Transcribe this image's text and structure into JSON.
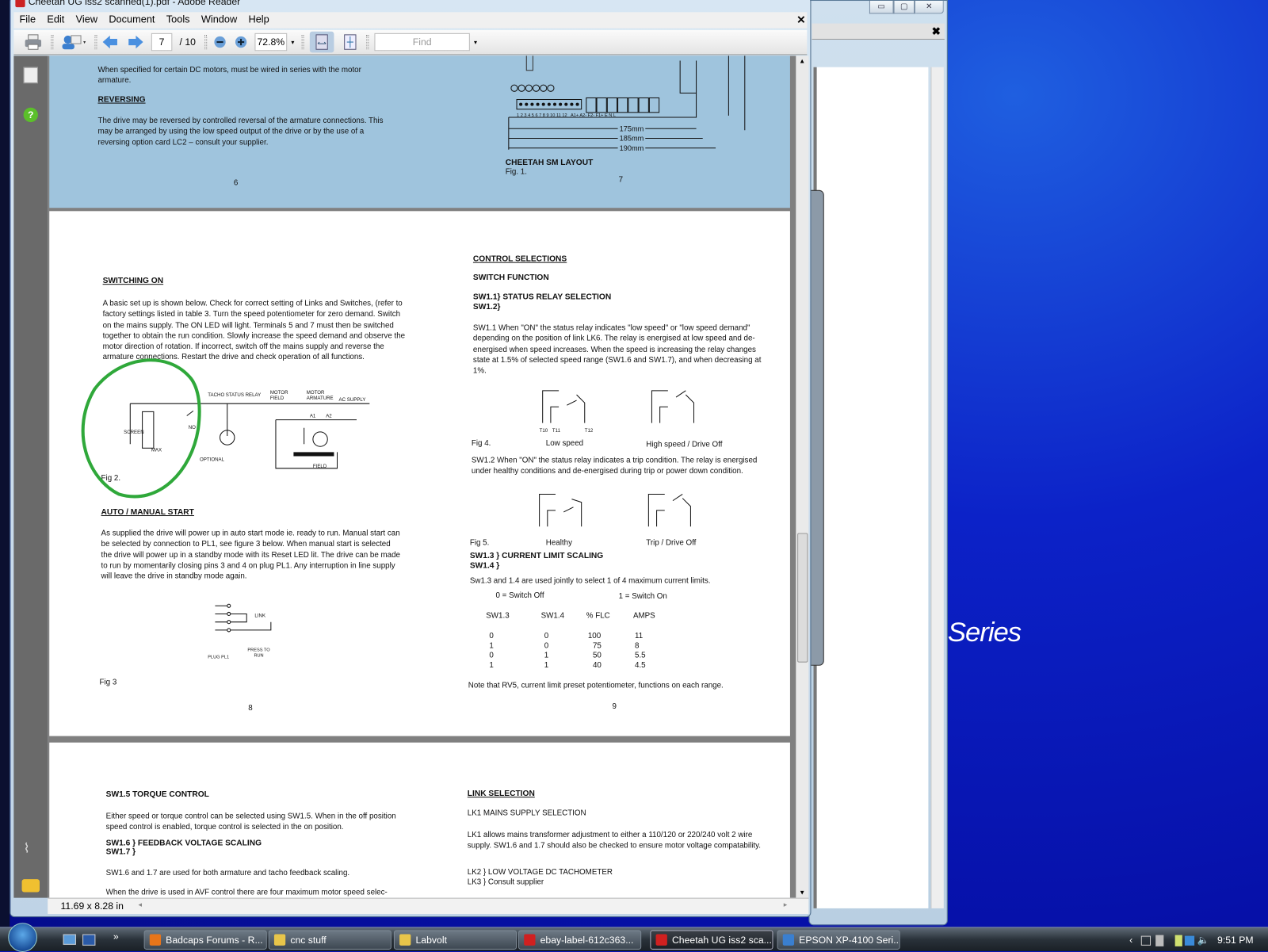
{
  "window": {
    "title": "Cheetah UG iss2 scanned(1).pdf - Adobe Reader",
    "close": "✕"
  },
  "menu": [
    "File",
    "Edit",
    "View",
    "Document",
    "Tools",
    "Window",
    "Help"
  ],
  "toolbar": {
    "page_current": "7",
    "page_total": "/ 10",
    "zoom": "72.8%",
    "find_placeholder": "Find"
  },
  "status": {
    "page_size": "11.69 x 8.28 in"
  },
  "page_a": {
    "left_text": "When specified for certain DC motors, must be wired in series with the motor armature.",
    "reversing_heading": "REVERSING",
    "reversing_text": "The drive may be reversed by controlled reversal of the armature connections.  This may be arranged by using the low speed output of the drive or by the use of a reversing option card LC2  –  consult your supplier.",
    "page_left": "6",
    "page_right": "7",
    "dims": [
      "175mm",
      "185mm",
      "190mm"
    ],
    "terminals": "1 2 3 4 5 6 7 8 9 10 11 12   A1+ A2- F2- F1+ E N L",
    "fig_title": "CHEETAH SM LAYOUT",
    "fig_caption": "Fig. 1."
  },
  "page_b": {
    "switching_heading": "SWITCHING ON",
    "switching_text": "A basic set up is shown below.  Check for correct setting of Links and Switches, (refer to factory settings listed in table 3.  Turn the speed potentiometer for zero demand. Switch on the mains supply.  The ON LED will light.  Terminals 5 and 7 must then be switched together to obtain the run condition.  Slowly increase the speed demand and observe the motor direction of rotation.  If incorrect, switch off the mains supply and reverse the armature connections.  Restart the drive and check operation of all functions.",
    "fig2_labels": [
      "STATUS RELAY",
      "MOTOR FIELD",
      "MOTOR ARMATURE",
      "AC SUPPLY",
      "TACHO",
      "SCREEN",
      "MAX",
      "NO",
      "OPTIONAL",
      "FIELD",
      "A1",
      "A2"
    ],
    "fig2_caption": "Fig 2.",
    "auto_heading": "AUTO / MANUAL START",
    "auto_text": "As supplied the drive will power up in auto start mode  ie. ready to run.  Manual start can be selected by connection to PL1, see figure 3 below.  When manual start is selected the drive will power up in a standby mode with its Reset LED lit.  The drive can be made to run by  momentarily closing pins 3 and 4 on plug PL1.  Any interruption in line supply will leave the drive in standby mode again.",
    "fig3_labels": [
      "LINK",
      "PRESS TO RUN",
      "PLUG PL1"
    ],
    "fig3_caption": "Fig 3",
    "page_left": "8",
    "control_heading": "CONTROL SELECTIONS",
    "switch_function": "SWITCH FUNCTION",
    "sw11_heading": "SW1.1}  STATUS RELAY SELECTION",
    "sw12_heading": "SW1.2}",
    "sw11_text": "SW1.1    When \"ON\" the status relay indicates \"low speed\" or \"low speed demand\" depending on the position of link LK6.  The relay is energised at low speed and de-energised when speed increases.  When the speed is increasing the relay changes state at 1.5% of selected speed range (SW1.6 and SW1.7), and when decreasing at 1%.",
    "fig4_caption": "Fig 4.",
    "fig4_low": "Low speed",
    "fig4_high": "High speed / Drive Off",
    "relay_terms": [
      "T10",
      "T11",
      "T12"
    ],
    "sw12_text": "SW1.2    When \"ON\" the status relay indicates a trip condition.  The relay is energised under healthy conditions and de-energised during trip or power down condition.",
    "fig5_caption": "Fig 5.",
    "fig5_healthy": "Healthy",
    "fig5_trip": "Trip / Drive Off",
    "sw13_heading": "SW1.3 } CURRENT LIMIT SCALING",
    "sw14_heading": "SW1.4 }",
    "sw13_text": "Sw1.3 and 1.4 are used jointly to select 1 of 4 maximum current limits.",
    "legend_off": "0  =  Switch Off",
    "legend_on": "1  =  Switch On",
    "table": {
      "headers": [
        "SW1.3",
        "SW1.4",
        "% FLC",
        "AMPS"
      ],
      "rows": [
        [
          "0",
          "0",
          "100",
          "11"
        ],
        [
          "1",
          "0",
          "75",
          "8"
        ],
        [
          "0",
          "1",
          "50",
          "5.5"
        ],
        [
          "1",
          "1",
          "40",
          "4.5"
        ]
      ]
    },
    "note": "Note that RV5, current limit preset potentiometer, functions on each range.",
    "page_right": "9"
  },
  "page_c": {
    "torque_heading": "SW1.5 TORQUE CONTROL",
    "torque_text": "Either speed or torque control can be selected using SW1.5.  When in the off position speed control is enabled, torque control is selected in the on position.",
    "fb_heading": "SW1.6 }  FEEDBACK VOLTAGE SCALING",
    "fb_heading2": "SW1.7 }",
    "fb_text": "SW1.6 and 1.7 are used for both armature and tacho feedback scaling.",
    "avf_text": "When the drive is used in AVF control there are four maximum motor speed selec-",
    "link_heading": "LINK SELECTION",
    "lk1_heading": "LK1 MAINS SUPPLY SELECTION",
    "lk1_text": "LK1 allows mains transformer adjustment to either a 110/120 or 220/240 volt 2 wire supply.   SW1.6 and 1.7 should also be checked to ensure motor voltage compatability.",
    "lk2": "LK2 }  LOW VOLTAGE DC TACHOMETER",
    "lk3": "LK3 }  Consult supplier"
  },
  "desktop": {
    "wallpaper_text": "Series"
  },
  "taskbar": {
    "items": [
      {
        "label": "Badcaps Forums - R...",
        "color": "#e8751a"
      },
      {
        "label": "cnc stuff",
        "color": "#e8c54a"
      },
      {
        "label": "Labvolt",
        "color": "#e8c54a"
      },
      {
        "label": "ebay-label-612c363...",
        "color": "#d02020"
      },
      {
        "label": "Cheetah UG iss2 sca...",
        "color": "#d02020",
        "active": true
      },
      {
        "label": "EPSON XP-4100 Seri...",
        "color": "#3a7fd0"
      }
    ],
    "clock": "9:51 PM"
  }
}
